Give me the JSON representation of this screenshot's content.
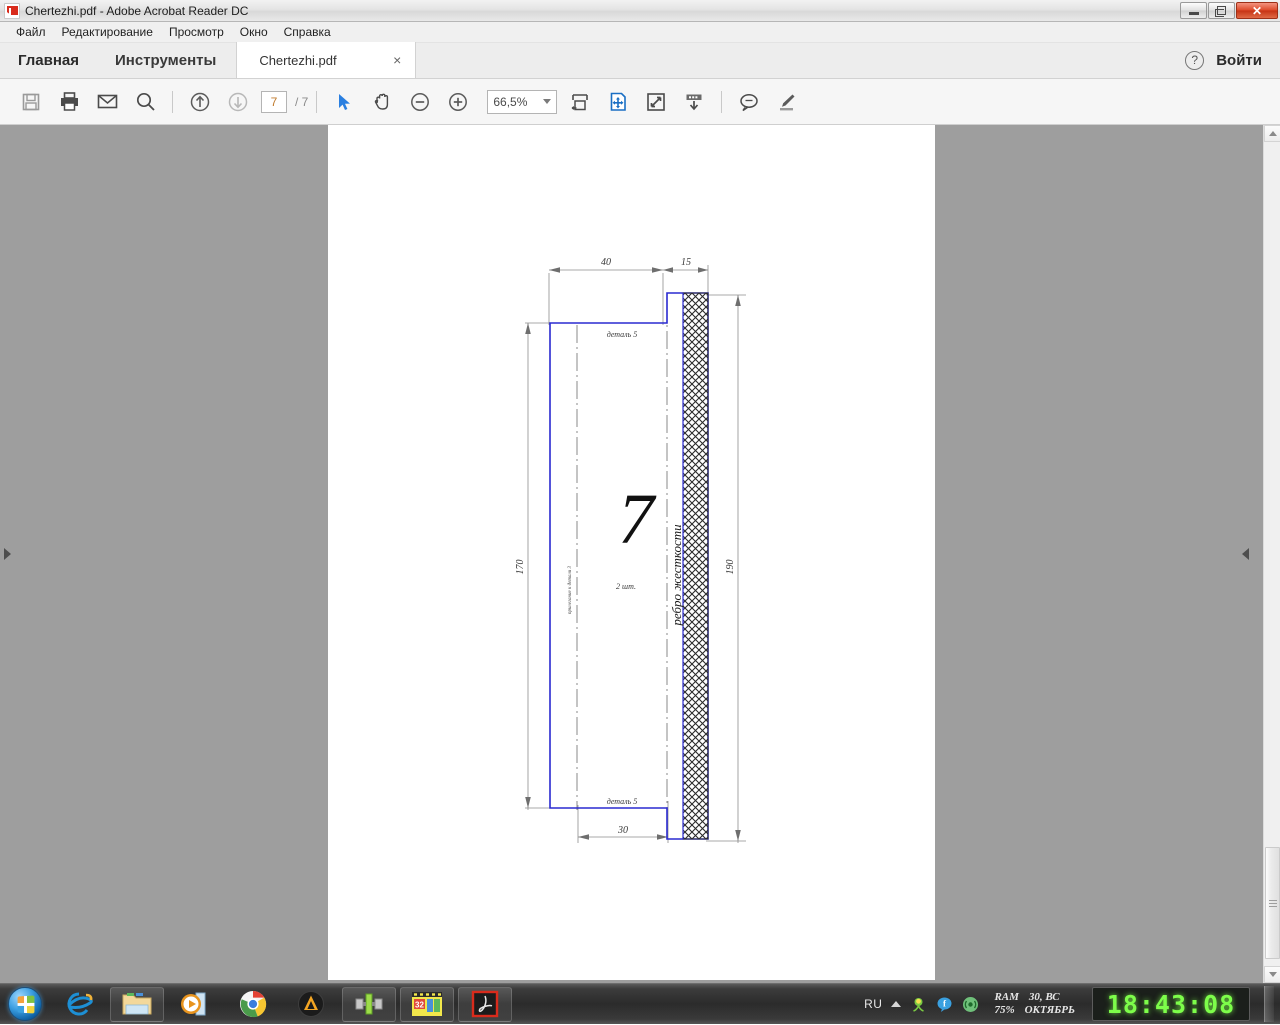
{
  "window": {
    "title": "Chertezhi.pdf - Adobe Acrobat Reader DC",
    "app_icon": "pdf-icon",
    "minimize_label": "—",
    "maximize_label": "❐",
    "close_label": "✕"
  },
  "menubar": {
    "items": [
      {
        "label": "Файл",
        "name": "menu-file"
      },
      {
        "label": "Редактирование",
        "name": "menu-edit"
      },
      {
        "label": "Просмотр",
        "name": "menu-view"
      },
      {
        "label": "Окно",
        "name": "menu-window"
      },
      {
        "label": "Справка",
        "name": "menu-help"
      }
    ]
  },
  "tabbar": {
    "home_label": "Главная",
    "tools_label": "Инструменты",
    "document_tab": "Chertezhi.pdf",
    "document_tab_close": "×",
    "help_glyph": "?",
    "signin_label": "Войти"
  },
  "toolbar": {
    "save_icon": "save-icon",
    "print_icon": "print-icon",
    "email_icon": "email-icon",
    "search_icon": "search-icon",
    "prev_page_icon": "arrow-up-circle-icon",
    "next_page_icon": "arrow-down-circle-icon",
    "page_current": "7",
    "page_total": "/ 7",
    "select_tool_icon": "cursor-arrow-icon",
    "hand_tool_icon": "hand-icon",
    "zoom_out_icon": "zoom-out-icon",
    "zoom_in_icon": "zoom-in-icon",
    "zoom_value": "66,5%",
    "zoom_dropdown_icon": "chevron-down-icon",
    "fit_width_icon": "fit-width-icon",
    "fit_page_icon": "fit-page-icon",
    "fullscreen_icon": "fullscreen-icon",
    "scroll_mode_icon": "scroll-mode-icon",
    "comment_icon": "comment-bubble-icon",
    "highlight_icon": "highlighter-icon"
  },
  "document": {
    "left_panel_arrow": "chevron-right-icon",
    "right_panel_arrow": "chevron-left-icon",
    "scroll_up_icon": "scroll-up-arrow",
    "scroll_down_icon": "scroll-down-arrow"
  },
  "drawing": {
    "part_number": "7",
    "quantity": "2 шт.",
    "rib_label": "ребро жесткости",
    "top_detail_label": "деталь 5",
    "bottom_detail_label": "деталь 5",
    "fit_note": "прилегание к детали 3",
    "dim_top_left": "40",
    "dim_top_right": "15",
    "dim_bottom": "30",
    "dim_left_height": "170",
    "dim_right_height": "190",
    "outline_color": "#2a2ad0",
    "hatch_color": "#2b2b2b"
  },
  "taskbar": {
    "start_icon": "windows-start-orb",
    "apps": [
      {
        "name": "taskbar-internet-explorer",
        "icon": "internet-explorer-icon"
      },
      {
        "name": "taskbar-file-explorer",
        "icon": "folder-icon"
      },
      {
        "name": "taskbar-media-player",
        "icon": "windows-media-player-icon"
      },
      {
        "name": "taskbar-chrome",
        "icon": "google-chrome-icon"
      },
      {
        "name": "taskbar-aimp",
        "icon": "aimp-icon"
      },
      {
        "name": "taskbar-editor",
        "icon": "green-tool-icon"
      },
      {
        "name": "taskbar-movie-maker",
        "icon": "movie-maker-icon"
      },
      {
        "name": "taskbar-acrobat",
        "icon": "adobe-acrobat-icon"
      }
    ],
    "tray": {
      "language": "RU",
      "expand_icon": "chevron-up-icon",
      "icons": [
        {
          "name": "tray-icq-icon",
          "icon": "icq-flower-icon"
        },
        {
          "name": "tray-messenger-icon",
          "icon": "blue-balloon-icon"
        },
        {
          "name": "tray-network-icon",
          "icon": "network-signal-icon"
        }
      ],
      "ram_label": "RAM",
      "ram_value": "75%",
      "date_day": "30, ВС",
      "date_month": "ОКТЯБРЬ",
      "clock": "18:43:08"
    },
    "show_desktop": "show-desktop-button"
  }
}
